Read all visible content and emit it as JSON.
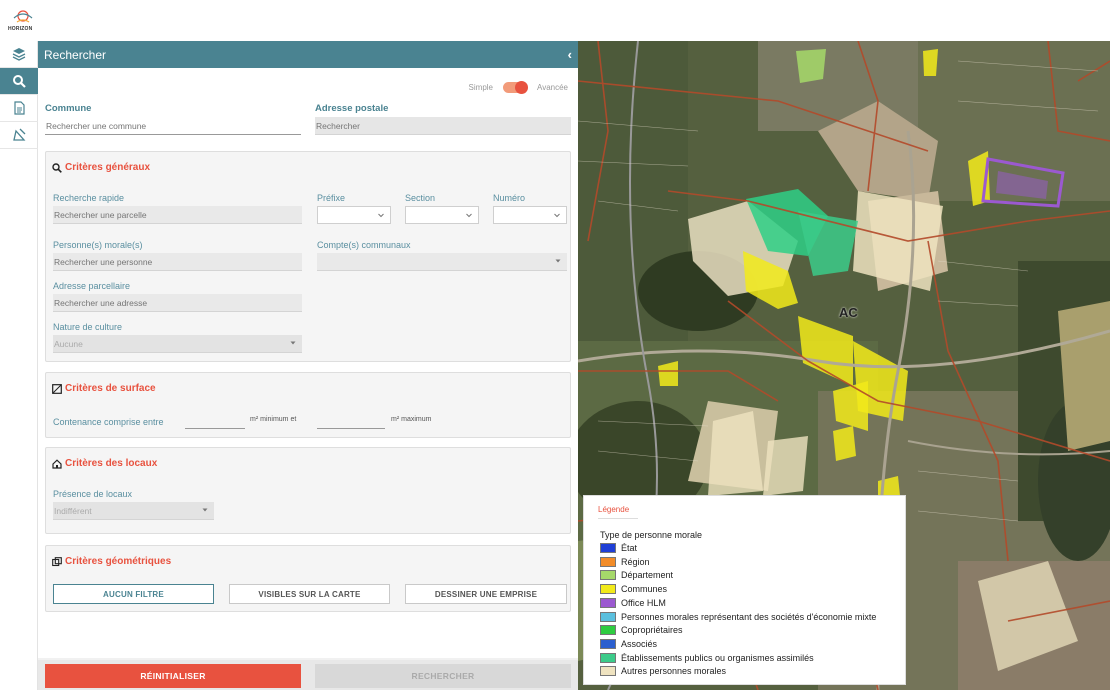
{
  "app": {
    "logo_text": "HORIZON"
  },
  "rail": {
    "items": [
      {
        "name": "layers"
      },
      {
        "name": "search"
      },
      {
        "name": "document"
      },
      {
        "name": "measure"
      }
    ]
  },
  "panel": {
    "title": "Rechercher",
    "collapse": "‹",
    "mode_simple": "Simple",
    "mode_advanced": "Avancée",
    "commune_label": "Commune",
    "commune_placeholder": "Rechercher une commune",
    "adresse_label": "Adresse postale",
    "adresse_placeholder": "Rechercher"
  },
  "general": {
    "title": "Critères généraux",
    "quick_label": "Recherche rapide",
    "quick_placeholder": "Rechercher une parcelle",
    "prefix_label": "Préfixe",
    "section_label": "Section",
    "number_label": "Numéro",
    "moral_label": "Personne(s) morale(s)",
    "moral_placeholder": "Rechercher une personne",
    "communal_label": "Compte(s) communaux",
    "address_label": "Adresse parcellaire",
    "address_placeholder": "Rechercher une adresse",
    "culture_label": "Nature de culture",
    "culture_value": "Aucune"
  },
  "surface": {
    "title": "Critères de surface",
    "label": "Contenance comprise entre",
    "unit_min": "m² minimum et",
    "unit_max": "m² maximum"
  },
  "locaux": {
    "title": "Critères des locaux",
    "presence_label": "Présence de locaux",
    "presence_value": "Indifférent"
  },
  "geo": {
    "title": "Critères géométriques",
    "btn_none": "AUCUN FILTRE",
    "btn_visible": "VISIBLES SUR LA CARTE",
    "btn_draw": "DESSINER UNE EMPRISE"
  },
  "actions": {
    "reset": "RÉINITIALISER",
    "search": "RECHERCHER"
  },
  "map": {
    "section_label": "AC"
  },
  "legend": {
    "title": "Légende",
    "heading": "Type de personne morale",
    "items": [
      {
        "label": "État",
        "color": "#1f3fd6"
      },
      {
        "label": "Région",
        "color": "#f28c28"
      },
      {
        "label": "Département",
        "color": "#a6d96a"
      },
      {
        "label": "Communes",
        "color": "#f2ea1a"
      },
      {
        "label": "Office HLM",
        "color": "#9b59d0"
      },
      {
        "label": "Personnes morales représentant des sociétés d'économie mixte",
        "color": "#5bc0de"
      },
      {
        "label": "Copropriétaires",
        "color": "#2ecc40"
      },
      {
        "label": "Associés",
        "color": "#2b5fcf"
      },
      {
        "label": "Établissements publics ou organismes assimilés",
        "color": "#3ccb8a"
      },
      {
        "label": "Autres personnes morales",
        "color": "#efe3c0"
      }
    ]
  },
  "colors": {
    "accent": "#4a8391",
    "danger": "#e8523f"
  }
}
